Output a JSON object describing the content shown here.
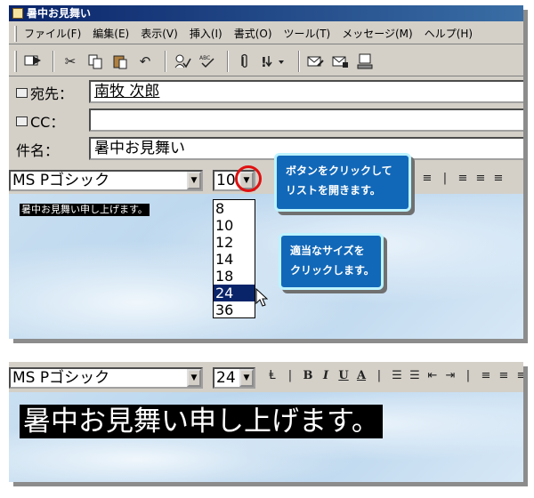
{
  "window": {
    "title": "暑中お見舞い"
  },
  "menu": {
    "items": [
      "ファイル(F)",
      "編集(E)",
      "表示(V)",
      "挿入(I)",
      "書式(O)",
      "ツール(T)",
      "メッセージ(M)",
      "ヘルプ(H)"
    ]
  },
  "toolbar": {
    "buttons": [
      "send-icon",
      "cut-icon",
      "copy-icon",
      "paste-icon",
      "undo-icon",
      "check-names-icon",
      "spelling-icon",
      "attach-icon",
      "priority-icon",
      "sign-icon",
      "encrypt-icon",
      "offline-icon"
    ]
  },
  "header": {
    "to_label": "宛先：",
    "to_value": "南牧 次郎",
    "cc_label": "CC：",
    "cc_value": "",
    "subject_label": "件名：",
    "subject_value": "暑中お見舞い"
  },
  "format": {
    "font": "MS Pゴシック",
    "size_before": "10",
    "size_after": "24"
  },
  "body": {
    "text": "暑中お見舞い申し上げます。"
  },
  "size_list": {
    "items": [
      "8",
      "10",
      "12",
      "14",
      "18",
      "24",
      "36"
    ],
    "highlighted": "24"
  },
  "callouts": {
    "c1_line1": "ボタンをクリックして",
    "c1_line2": "リストを開きます。",
    "c2_line1": "適当なサイズを",
    "c2_line2": "クリックします。"
  },
  "colors": {
    "callout": "#1268b8",
    "highlight_circle": "#e01010",
    "selection": "#0a246a"
  }
}
